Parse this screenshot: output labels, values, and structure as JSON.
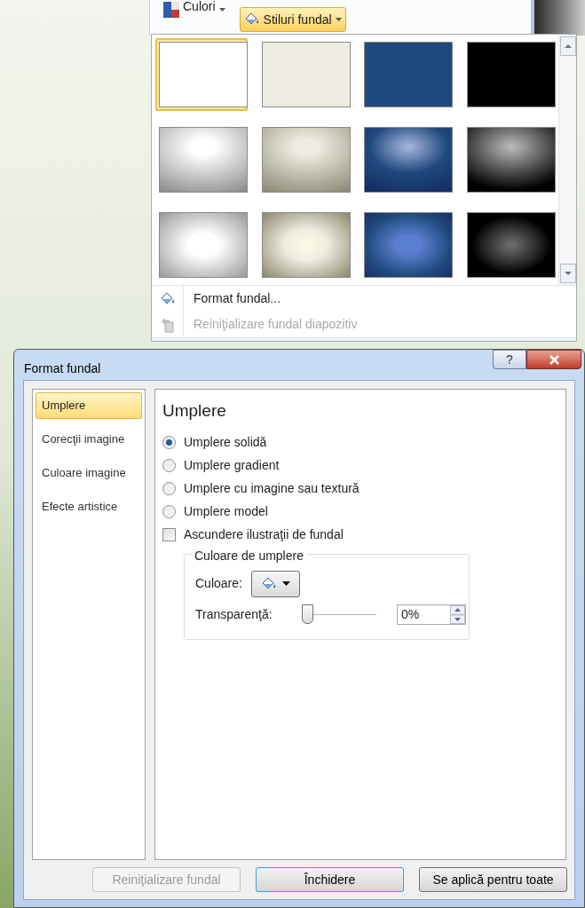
{
  "ribbon": {
    "colors_button": "Culori",
    "styles_button": {
      "label": "Stiluri fundal",
      "selected": true
    }
  },
  "gallery": {
    "swatches": [
      {
        "kind": "solid",
        "color": "#ffffff",
        "selected": true
      },
      {
        "kind": "solid",
        "color": "#eeece1",
        "selected": false
      },
      {
        "kind": "solid",
        "color": "#1f497d",
        "selected": false
      },
      {
        "kind": "solid",
        "color": "#000000",
        "selected": false
      },
      {
        "kind": "linear",
        "color": "#ffffff",
        "selected": false
      },
      {
        "kind": "linear",
        "color": "#eeece1",
        "selected": false
      },
      {
        "kind": "linear",
        "color": "#1f497d",
        "selected": false
      },
      {
        "kind": "linear",
        "color": "#000000",
        "selected": false
      },
      {
        "kind": "radial",
        "color": "#ffffff",
        "selected": false
      },
      {
        "kind": "radial",
        "color": "#eeece1",
        "selected": false
      },
      {
        "kind": "radial",
        "color": "#1f497d",
        "selected": false
      },
      {
        "kind": "radial",
        "color": "#000000",
        "selected": false
      }
    ],
    "menu": [
      {
        "label": "Format fundal...",
        "disabled": false
      },
      {
        "label": "Reiniţializare fundal diapozitiv",
        "disabled": true
      }
    ]
  },
  "dialog": {
    "title": "Format fundal",
    "help": "?",
    "sidebar": [
      {
        "label": "Umplere",
        "selected": true
      },
      {
        "label": "Corecţii imagine",
        "selected": false
      },
      {
        "label": "Culoare imagine",
        "selected": false
      },
      {
        "label": "Efecte artistice",
        "selected": false
      }
    ],
    "heading": "Umplere",
    "fill_options": [
      {
        "label": "Umplere solidă",
        "selected": true
      },
      {
        "label": "Umplere gradient",
        "selected": false
      },
      {
        "label": "Umplere cu imagine sau textură",
        "selected": false
      },
      {
        "label": "Umplere model",
        "selected": false
      }
    ],
    "hide_graphics": {
      "label": "Ascundere ilustraţii de fundal",
      "checked": false
    },
    "group": {
      "title": "Culoare de umplere",
      "color_label": "Culoare:",
      "transparency_label": "Transparenţă:",
      "transparency": {
        "level": 0
      },
      "transparency_value": "0%"
    },
    "buttons": [
      {
        "label": "Reiniţializare fundal",
        "disabled": true,
        "default": false
      },
      {
        "label": "Închidere",
        "disabled": false,
        "default": true
      },
      {
        "label": "Se aplică pentru toate",
        "disabled": false,
        "default": false
      }
    ]
  }
}
